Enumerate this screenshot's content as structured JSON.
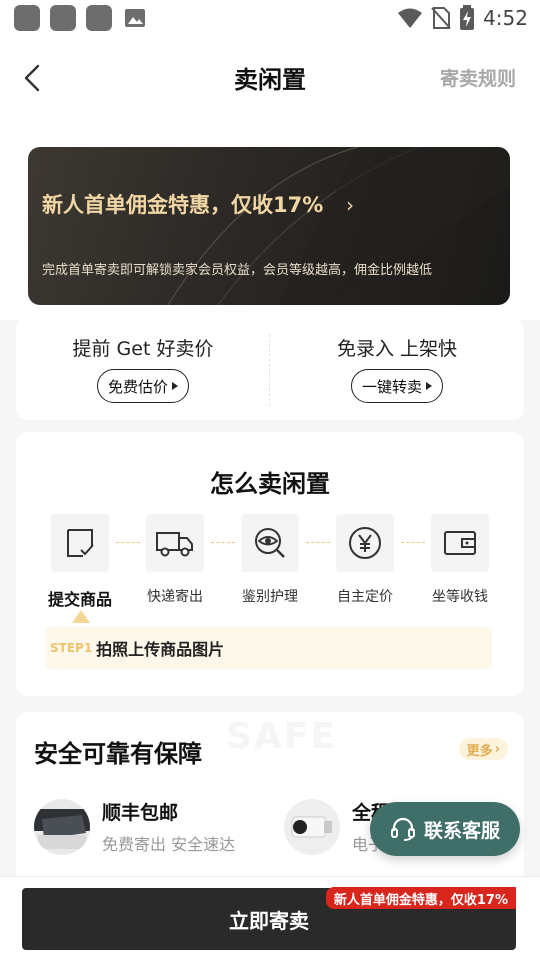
{
  "status_bar": {
    "time": "4:52"
  },
  "header": {
    "title": "卖闲置",
    "rules_link": "寄卖规则"
  },
  "banner": {
    "title": "新人首单佣金特惠，仅收17%",
    "description": "完成首单寄卖即可解锁卖家会员权益，会员等级越高，佣金比例越低"
  },
  "quick_actions": [
    {
      "label": "提前 Get 好卖价",
      "button": "免费估价"
    },
    {
      "label": "免录入 上架快",
      "button": "一键转卖"
    }
  ],
  "how_to_sell": {
    "title": "怎么卖闲置",
    "steps": [
      {
        "label": "提交商品",
        "icon": "check-doc-icon"
      },
      {
        "label": "快递寄出",
        "icon": "truck-icon"
      },
      {
        "label": "鉴别护理",
        "icon": "magnify-eye-icon"
      },
      {
        "label": "自主定价",
        "icon": "yuan-icon"
      },
      {
        "label": "坐等收钱",
        "icon": "wallet-icon"
      }
    ],
    "active_step_tag": "STEP1",
    "active_step_desc": "拍照上传商品图片"
  },
  "safety": {
    "watermark": "SAFE",
    "title": "安全可靠有保障",
    "more": "更多",
    "guarantees": [
      {
        "name": "顺丰包邮",
        "sub": "免费寄出 安全速达"
      },
      {
        "name": "全程监控",
        "sub": "电子..."
      }
    ]
  },
  "service_button": "联系客服",
  "bottom_cta": {
    "label": "立即寄卖",
    "badge": "新人首单佣金特惠，仅收17%"
  },
  "colors": {
    "gold": "#f2d7a5",
    "accent_red": "#d9261c",
    "service_green": "#3f6f68",
    "dark": "#2a2a2a"
  }
}
